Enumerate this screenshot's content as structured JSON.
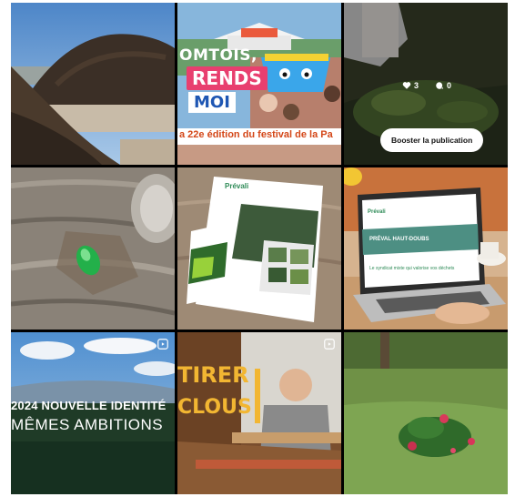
{
  "posts": [
    {
      "id": "compost"
    },
    {
      "id": "festival",
      "line1": "OMTOIS,",
      "line2": "RENDS",
      "line3": "MOI",
      "edition": "a 22e édition du festival de la Pa"
    },
    {
      "id": "garden",
      "likes": "3",
      "comments": "0",
      "boost_label": "Booster la publication"
    },
    {
      "id": "beetle"
    },
    {
      "id": "brochure",
      "brand": "Prévali"
    },
    {
      "id": "laptop",
      "brand": "Prévali",
      "banner": "PRÉVAL HAUT-DOUBS",
      "caption": "Le syndicat mixte qui valorise vos déchets"
    },
    {
      "id": "identity",
      "line1": "2024 NOUVELLE IDENTITÉ",
      "line2": "MÊMES AMBITIONS"
    },
    {
      "id": "workshop",
      "word1": "TIRER",
      "word2": "CLOUS"
    },
    {
      "id": "flowers"
    }
  ],
  "colors": {
    "festival_pink": "#e83f6f",
    "festival_blue": "#1e56b3",
    "workshop_yellow": "#f2b632"
  }
}
